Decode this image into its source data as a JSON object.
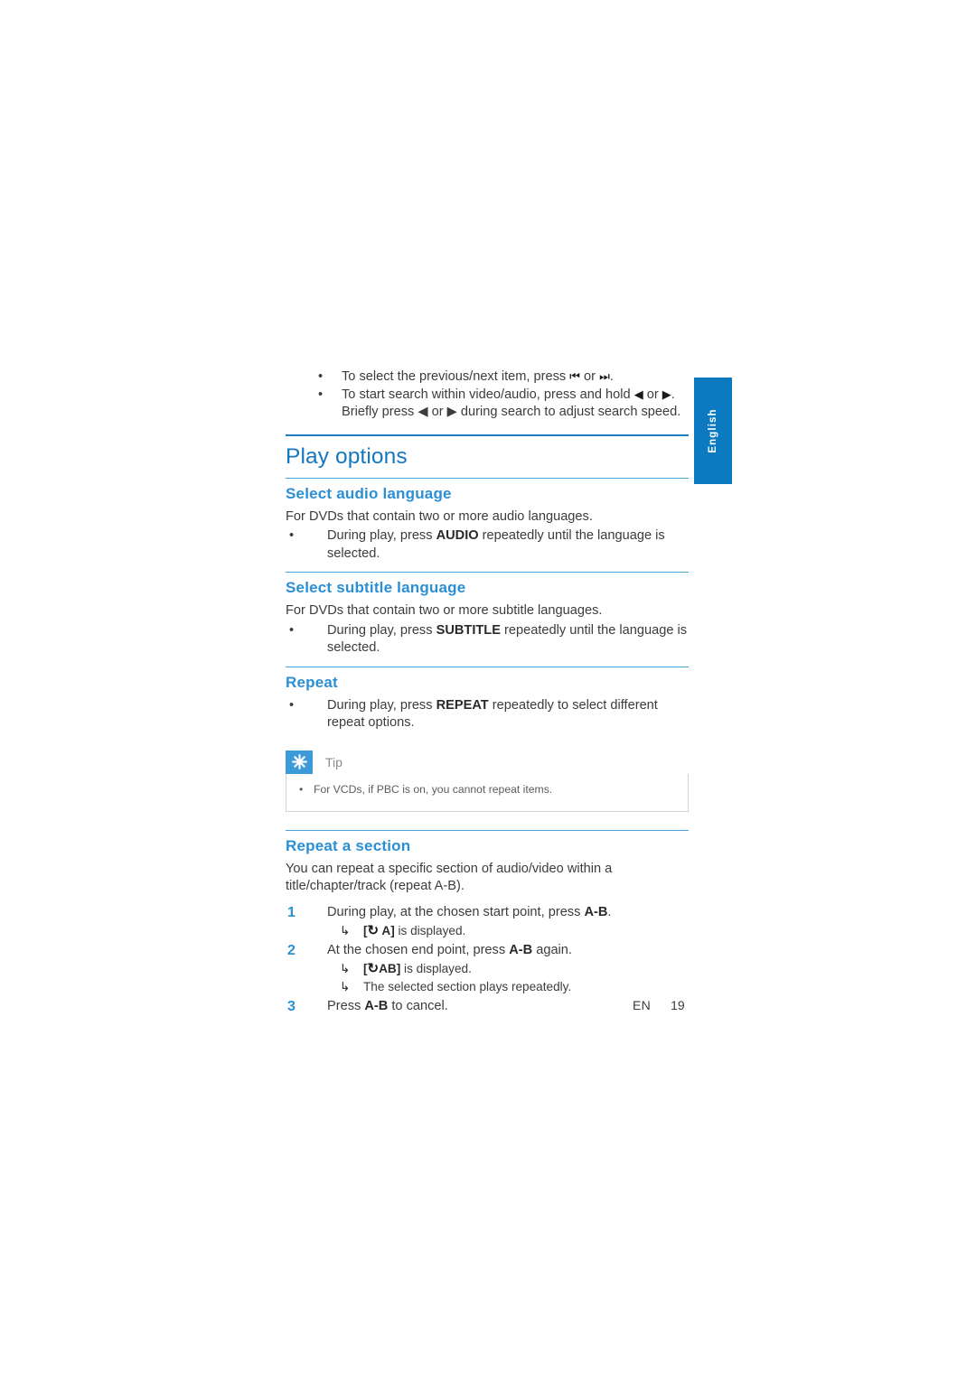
{
  "sidebar": {
    "language_tab": "English"
  },
  "intro_bullets": [
    {
      "text_before": "To select the previous/next item, press ",
      "glyph_a": "⏮",
      "mid": " or ",
      "glyph_b": "⏭",
      "text_after": "."
    },
    {
      "text_before": "To start search within video/audio, press and hold ",
      "glyph_a": "◀",
      "mid": " or ",
      "glyph_b": "▶",
      "text_after": ". Briefly press ◀ or ▶ during search to adjust search speed."
    }
  ],
  "section": {
    "title": "Play options"
  },
  "audio_language": {
    "heading": "Select audio language",
    "intro": "For DVDs that contain two or more audio languages.",
    "bullet_before": "During play, press ",
    "bullet_key": "AUDIO",
    "bullet_after": " repeatedly until the language is selected."
  },
  "subtitle_language": {
    "heading": "Select subtitle language",
    "intro": "For DVDs that contain two or more subtitle languages.",
    "bullet_before": "During play, press ",
    "bullet_key": "SUBTITLE",
    "bullet_after": " repeatedly until the language is selected."
  },
  "repeat": {
    "heading": "Repeat",
    "bullet_before": "During play, press ",
    "bullet_key": "REPEAT",
    "bullet_after": " repeatedly to select different repeat options.",
    "tip": {
      "label": "Tip",
      "icon": "asterisk-icon",
      "text": "For VCDs, if PBC is on, you cannot repeat items."
    }
  },
  "repeat_section": {
    "heading": "Repeat a section",
    "intro": "You can repeat a specific section of audio/video within a title/chapter/track (repeat A-B).",
    "steps": [
      {
        "num": "1",
        "before": "During play, at the chosen start point, press ",
        "key": "A-B",
        "after": ".",
        "results": [
          {
            "tag_open": "[",
            "symbol": "↻",
            "tag_text": " A]",
            "rest": " is displayed."
          }
        ]
      },
      {
        "num": "2",
        "before": "At the chosen end point, press ",
        "key": "A-B",
        "after": " again.",
        "results": [
          {
            "tag_open": "[",
            "symbol": "↻",
            "tag_text": "AB]",
            "rest": " is displayed."
          },
          {
            "plain": "The selected section plays repeatedly."
          }
        ]
      },
      {
        "num": "3",
        "before": "Press ",
        "key": "A-B",
        "after": " to cancel.",
        "results": []
      }
    ]
  },
  "footer": {
    "lang_code": "EN",
    "page_number": "19"
  },
  "colors": {
    "heading_blue": "#2a8fd4",
    "section_blue": "#1577c0",
    "rule_blue": "#1a7fc1",
    "tab_blue": "#0b7ac0",
    "tip_icon_blue": "#3d9ad8",
    "body_text": "#3c3c3c"
  }
}
